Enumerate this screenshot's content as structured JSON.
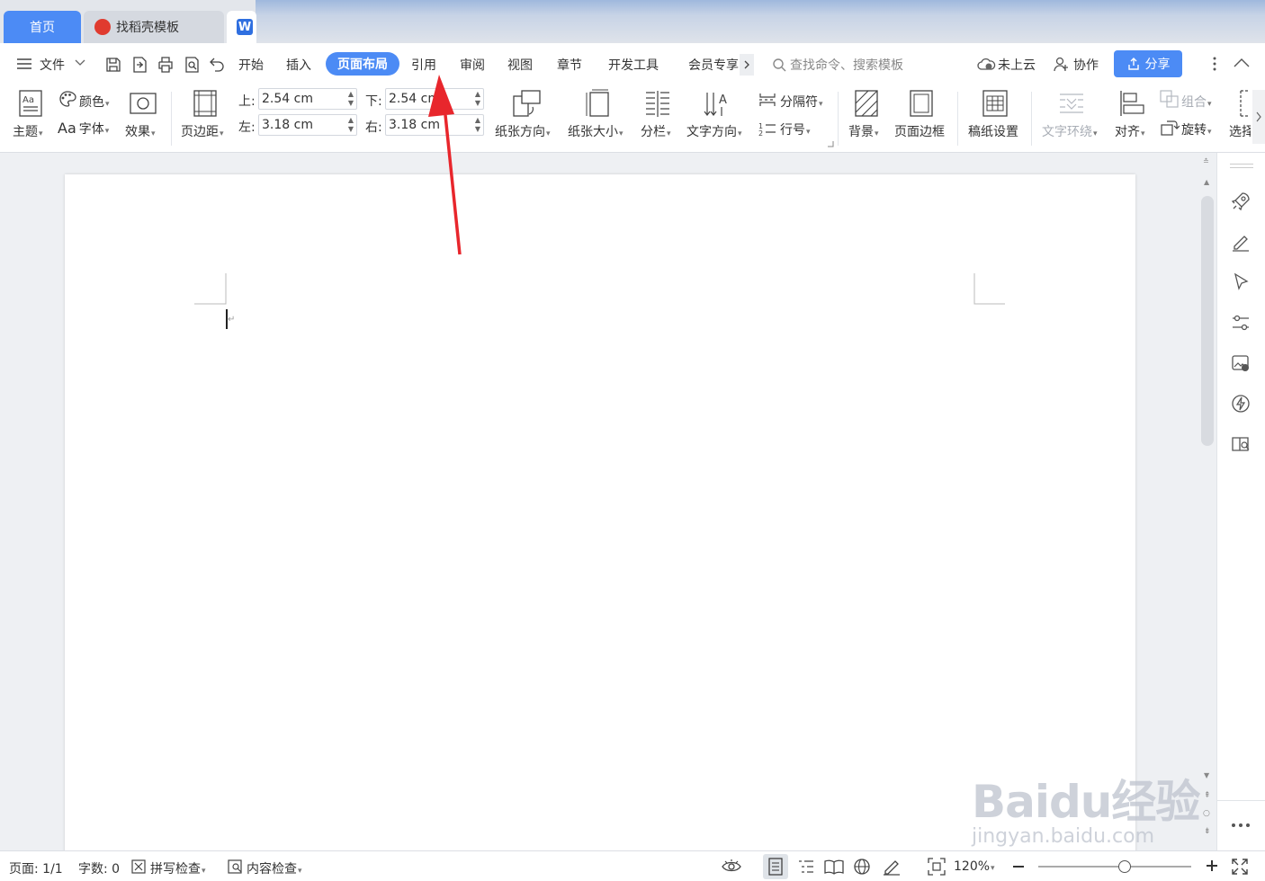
{
  "tabs": {
    "home": "首页",
    "template": "找稻壳模板",
    "doc_icon_letter": "W"
  },
  "menu": {
    "file": "文件",
    "items": [
      "开始",
      "插入",
      "页面布局",
      "引用",
      "审阅",
      "视图",
      "章节",
      "开发工具",
      "会员专享"
    ],
    "active_index": 2,
    "search_placeholder": "查找命令、搜索模板",
    "cloud": "未上云",
    "collab": "协作",
    "share": "分享"
  },
  "ribbon": {
    "theme": "主题",
    "color": "颜色",
    "font": "字体",
    "font_prefix": "Aa",
    "effect": "效果",
    "margins": "页边距",
    "top_label": "上:",
    "top_value": "2.54 cm",
    "bottom_label": "下:",
    "bottom_value": "2.54 cm",
    "left_label": "左:",
    "left_value": "3.18 cm",
    "right_label": "右:",
    "right_value": "3.18 cm",
    "orientation": "纸张方向",
    "size": "纸张大小",
    "columns": "分栏",
    "text_direction": "文字方向",
    "breaks": "分隔符",
    "line_numbers": "行号",
    "background": "背景",
    "page_border": "页面边框",
    "manuscript": "稿纸设置",
    "text_wrap": "文字环绕",
    "align": "对齐",
    "group": "组合",
    "rotate": "旋转",
    "select": "选择"
  },
  "status": {
    "page": "页面: 1/1",
    "words": "字数: 0",
    "spell": "拼写检查",
    "content_check": "内容检查",
    "zoom": "120%",
    "zoom_level_percent": 120
  },
  "watermark": {
    "brand": "Baidu经验",
    "url": "jingyan.baidu.com"
  },
  "colors": {
    "accent": "#4c8bf5",
    "annotation_arrow": "#e8262c"
  }
}
